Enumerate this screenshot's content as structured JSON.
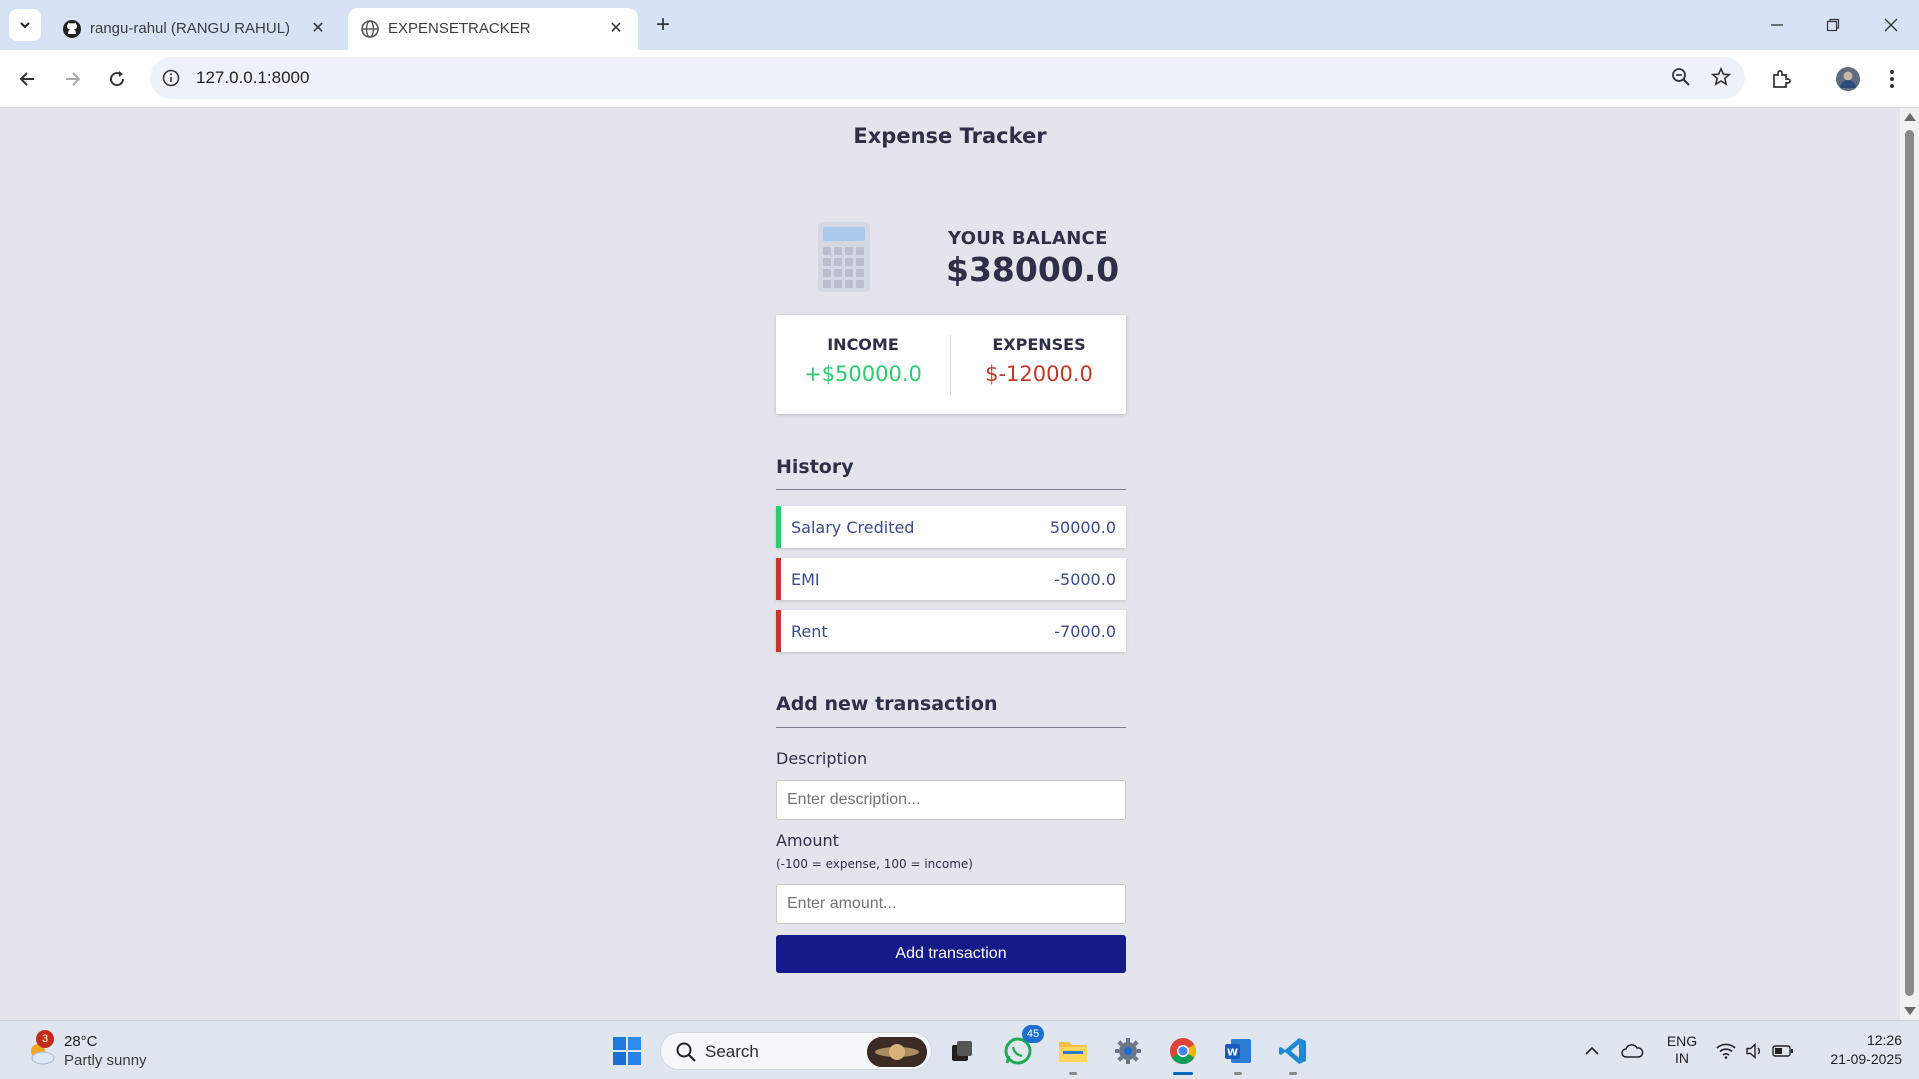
{
  "browser": {
    "tabs": [
      {
        "title": "rangu-rahul (RANGU RAHUL)",
        "favicon": "github-icon",
        "active": false
      },
      {
        "title": "EXPENSETRACKER",
        "favicon": "globe-icon",
        "active": true
      }
    ],
    "url": "127.0.0.1:8000"
  },
  "page": {
    "title": "Expense Tracker",
    "balance": {
      "label": "YOUR BALANCE",
      "value": "$38000.0"
    },
    "summary": {
      "income_label": "INCOME",
      "income_value": "+$50000.0",
      "expense_label": "EXPENSES",
      "expense_value": "$-12000.0"
    },
    "history": {
      "title": "History",
      "items": [
        {
          "description": "Salary Credited",
          "amount": "50000.0",
          "type": "income"
        },
        {
          "description": "EMI",
          "amount": "-5000.0",
          "type": "expense"
        },
        {
          "description": "Rent",
          "amount": "-7000.0",
          "type": "expense"
        }
      ]
    },
    "form": {
      "title": "Add new transaction",
      "description_label": "Description",
      "description_placeholder": "Enter description...",
      "amount_label": "Amount",
      "amount_hint": "(-100 = expense, 100 = income)",
      "amount_placeholder": "Enter amount...",
      "submit_label": "Add transaction"
    },
    "colors": {
      "income": "#2ecc71",
      "expense": "#c0392b",
      "button": "#151a8a",
      "background": "#e4e4ec"
    }
  },
  "taskbar": {
    "weather": {
      "badge": "3",
      "temp": "28°C",
      "condition": "Partly sunny"
    },
    "search_label": "Search",
    "whatsapp_badge": "45",
    "lang_line1": "ENG",
    "lang_line2": "IN",
    "time": "12:26",
    "date": "21-09-2025"
  }
}
